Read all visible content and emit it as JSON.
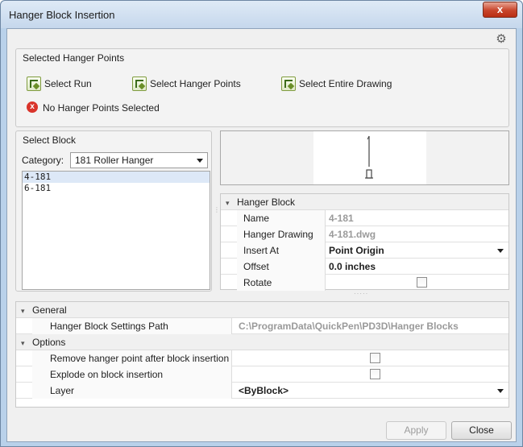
{
  "window": {
    "title": "Hanger Block Insertion",
    "close_glyph": "x"
  },
  "settings_icon": "gear-icon",
  "selected_points": {
    "title": "Selected Hanger Points",
    "buttons": [
      {
        "label": "Select Run",
        "icon": "select-run-icon"
      },
      {
        "label": "Select Hanger Points",
        "icon": "select-points-icon"
      },
      {
        "label": "Select Entire Drawing",
        "icon": "select-drawing-icon"
      }
    ],
    "status_text": "No Hanger Points Selected",
    "status_icon": "error-icon",
    "status_glyph": "x"
  },
  "select_block": {
    "title": "Select Block",
    "category_label": "Category:",
    "category_value": "181 Roller Hanger",
    "items": [
      "4-181",
      "6-181"
    ],
    "selected_index": 0
  },
  "hanger_block": {
    "section": "Hanger Block",
    "rows": [
      {
        "key": "Name",
        "value": "4-181"
      },
      {
        "key": "Hanger Drawing",
        "value": "4-181.dwg"
      },
      {
        "key": "Insert At",
        "value": "Point Origin"
      },
      {
        "key": "Offset",
        "value": "0.0 inches"
      },
      {
        "key": "Rotate",
        "checked": false
      }
    ]
  },
  "bottom_grid": {
    "general": {
      "section": "General",
      "path_label": "Hanger Block Settings Path",
      "path_value": "C:\\ProgramData\\QuickPen\\PD3D\\Hanger Blocks"
    },
    "options": {
      "section": "Options",
      "remove_label": "Remove hanger point after block insertion",
      "remove_checked": false,
      "explode_label": "Explode on block insertion",
      "explode_checked": false,
      "layer_label": "Layer",
      "layer_value": "<ByBlock>"
    }
  },
  "footer": {
    "apply_label": "Apply",
    "close_label": "Close"
  }
}
